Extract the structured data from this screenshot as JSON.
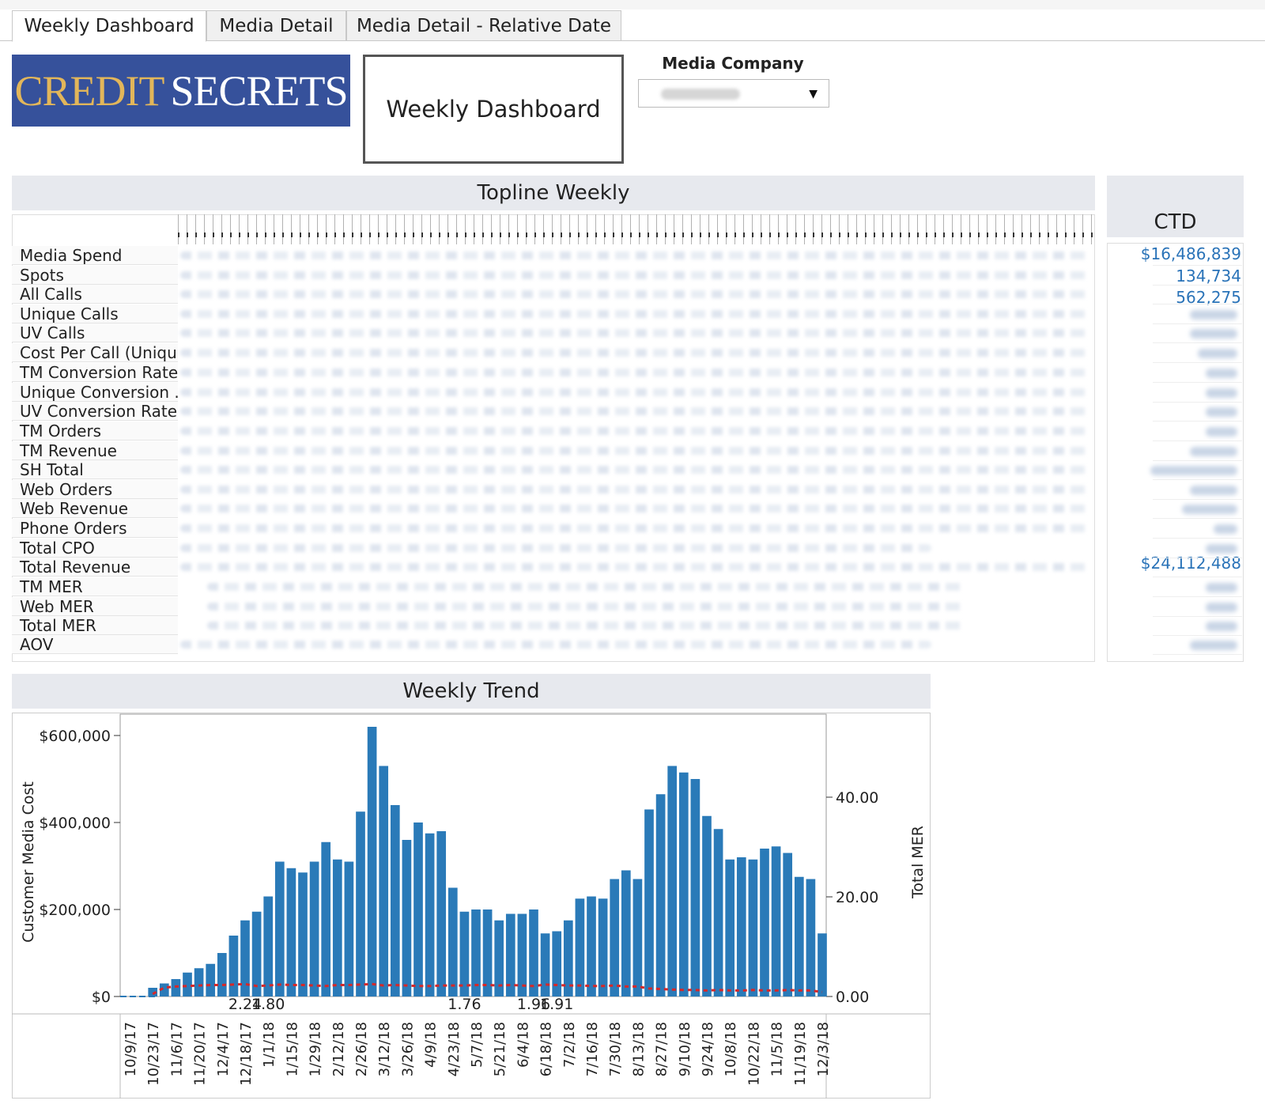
{
  "tabs": [
    {
      "label": "Weekly Dashboard",
      "active": true
    },
    {
      "label": "Media Detail",
      "active": false
    },
    {
      "label": "Media Detail - Relative Date",
      "active": false
    }
  ],
  "logo": {
    "word1": "CREDIT",
    "word2": "SECRETS"
  },
  "dashboard_title": "Weekly Dashboard",
  "media_company": {
    "label": "Media Company"
  },
  "topline": {
    "title": "Topline Weekly",
    "metrics": [
      "Media Spend",
      "Spots",
      "All Calls",
      "Unique Calls",
      "UV Calls",
      "Cost Per Call (Uniqu..",
      "TM Conversion Rate",
      "Unique Conversion ..",
      "UV Conversion Rate",
      "TM Orders",
      "TM Revenue",
      "SH Total",
      "Web Orders",
      "Web Revenue",
      "Phone Orders",
      "Total CPO",
      "Total Revenue",
      "TM MER",
      "Web MER",
      "Total MER",
      "AOV"
    ]
  },
  "ctd": {
    "title": "CTD",
    "media_spend": "$16,486,839",
    "spots": "134,734",
    "all_calls": "562,275",
    "total_revenue": "$24,112,488"
  },
  "trend": {
    "title": "Weekly Trend"
  },
  "chart_data": {
    "type": "bar",
    "title": "Weekly Trend",
    "ylabel": "Customer Media Cost",
    "y2label": "Total MER",
    "ylim": [
      0,
      620000
    ],
    "y2lim": [
      0,
      50
    ],
    "yticks": [
      "$0",
      "$200,000",
      "$400,000",
      "$600,000"
    ],
    "y2ticks": [
      "0.00",
      "20.00",
      "40.00"
    ],
    "tick_labels": [
      "10/9/17",
      "10/23/17",
      "11/6/17",
      "11/20/17",
      "12/4/17",
      "12/18/17",
      "1/1/18",
      "1/15/18",
      "1/29/18",
      "2/12/18",
      "2/26/18",
      "3/12/18",
      "3/26/18",
      "4/9/18",
      "4/23/18",
      "5/7/18",
      "5/21/18",
      "6/4/18",
      "6/18/18",
      "7/2/18",
      "7/16/18",
      "7/30/18",
      "8/13/18",
      "8/27/18",
      "9/10/18",
      "9/24/18",
      "10/8/18",
      "10/22/18",
      "11/5/18",
      "11/19/18",
      "12/3/18"
    ],
    "values": [
      0,
      0,
      20000,
      30000,
      40000,
      55000,
      65000,
      75000,
      100000,
      140000,
      175000,
      195000,
      230000,
      310000,
      295000,
      285000,
      310000,
      355000,
      315000,
      310000,
      425000,
      620000,
      530000,
      440000,
      360000,
      400000,
      375000,
      380000,
      250000,
      195000,
      200000,
      200000,
      175000,
      190000,
      190000,
      200000,
      145000,
      150000,
      175000,
      225000,
      230000,
      225000,
      270000,
      290000,
      270000,
      430000,
      465000,
      530000,
      515000,
      500000,
      415000,
      385000,
      315000,
      320000,
      315000,
      340000,
      345000,
      330000,
      275000,
      270000,
      145000
    ],
    "mer_values": [
      null,
      null,
      0.5,
      1.8,
      2.0,
      2.1,
      2.2,
      2.3,
      2.3,
      2.4,
      2.5,
      2.1,
      2.2,
      2.4,
      2.3,
      2.3,
      2.2,
      2.1,
      2.3,
      2.3,
      2.4,
      2.5,
      2.2,
      2.3,
      2.2,
      2.1,
      2.1,
      2.2,
      2.2,
      2.2,
      2.3,
      2.3,
      2.2,
      2.3,
      2.2,
      2.1,
      2.4,
      2.3,
      2.2,
      2.2,
      2.1,
      2.1,
      2.2,
      2.0,
      2.0,
      1.6,
      1.5,
      1.4,
      1.3,
      1.3,
      1.2,
      1.3,
      1.2,
      1.2,
      1.3,
      1.2,
      1.2,
      1.3,
      1.2,
      1.2,
      0.9
    ],
    "annotations": [
      {
        "index": 10,
        "text": "2.24"
      },
      {
        "index": 12,
        "text": "1.80"
      },
      {
        "index": 29,
        "text": "1.76"
      },
      {
        "index": 35,
        "text": "1.96"
      },
      {
        "index": 37,
        "text": "1.91"
      }
    ],
    "bar_color": "#2a7ab8",
    "mer_color": "#d62728",
    "grid": false
  }
}
